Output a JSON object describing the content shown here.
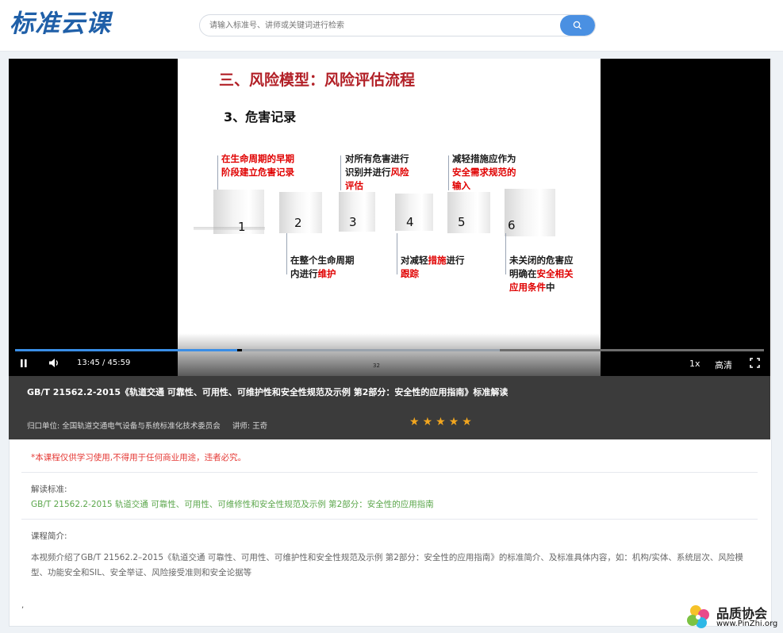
{
  "header": {
    "logo_text": "标准云课",
    "search_placeholder": "请输入标准号、讲师或关键词进行检索",
    "search_icon": "search-icon"
  },
  "player": {
    "slide": {
      "title": "三、风险模型：风险评估流程",
      "subtitle": "3、危害记录",
      "boxes": [
        "1",
        "2",
        "3",
        "4",
        "5",
        "6"
      ],
      "notes_top": [
        {
          "parts": [
            {
              "t": "在生命周期的",
              "red": true
            },
            {
              "t": "早期",
              "red": true
            },
            {
              "t": "",
              "red": false
            }
          ],
          "lines": [
            [
              "在生命周期的",
              "早期"
            ],
            [
              "阶段建立危害记录"
            ]
          ]
        },
        {
          "lines": [
            [
              "对所有危害进行"
            ],
            [
              "识别并进行",
              "风险"
            ],
            [
              "评估"
            ]
          ]
        },
        {
          "lines": [
            [
              "减轻措施应作为"
            ],
            [
              "安全需求规范的"
            ],
            [
              "输入"
            ]
          ]
        }
      ],
      "notes_bottom": [
        {
          "lines": [
            [
              "在整个生命周期"
            ],
            [
              "内进行",
              "维护"
            ]
          ]
        },
        {
          "lines": [
            [
              "对减轻",
              "措施",
              "进行"
            ],
            [
              "跟踪"
            ]
          ]
        },
        {
          "lines": [
            [
              "未关闭的危害应"
            ],
            [
              "明确在",
              "安全相关"
            ],
            [
              "应用条件",
              "中"
            ]
          ]
        }
      ],
      "page_no": "32"
    },
    "time": "13:45 / 45:59",
    "progress_played": 0.297,
    "progress_loaded": 0.647,
    "speed": "1x",
    "quality": "高清",
    "icons": {
      "play": "pause-icon",
      "volume": "volume-icon",
      "fullscreen": "fullscreen-icon"
    }
  },
  "course": {
    "title": "GB/T 21562.2-2015《轨道交通 可靠性、可用性、可维护性和安全性规范及示例 第2部分：安全性的应用指南》标准解读",
    "org_label": "归口单位:",
    "org": "全国轨道交通电气设备与系统标准化技术委员会",
    "lecturer_label": "讲师:",
    "lecturer": "王奇",
    "rating": 5
  },
  "notice": "*本课程仅供学习使用,不得用于任何商业用途，违者必究。",
  "standard": {
    "label": "解读标准:",
    "value": "GB/T 21562.2-2015 轨道交通 可靠性、可用性、可维修性和安全性规范及示例 第2部分：安全性的应用指南"
  },
  "intro": {
    "label": "课程简介:",
    "text": "本视频介绍了GB/T 21562.2–2015《轨道交通 可靠性、可用性、可维护性和安全性规范及示例 第2部分：安全性的应用指南》的标准简介、及标准具体内容，如：机构/实体、系统层次、风险模型、功能安全和SIL、安全举证、风险接受准则和安全论据等"
  },
  "stray": ",",
  "watermark": {
    "cn": "品质协会",
    "en": "www.PinZhi.org"
  },
  "colors": {
    "accent": "#3a8ee6",
    "brand": "#1f5fa8",
    "warning": "#e53935",
    "link": "#5aa64a",
    "star": "#f2a61f",
    "slide_title": "#b22027"
  }
}
